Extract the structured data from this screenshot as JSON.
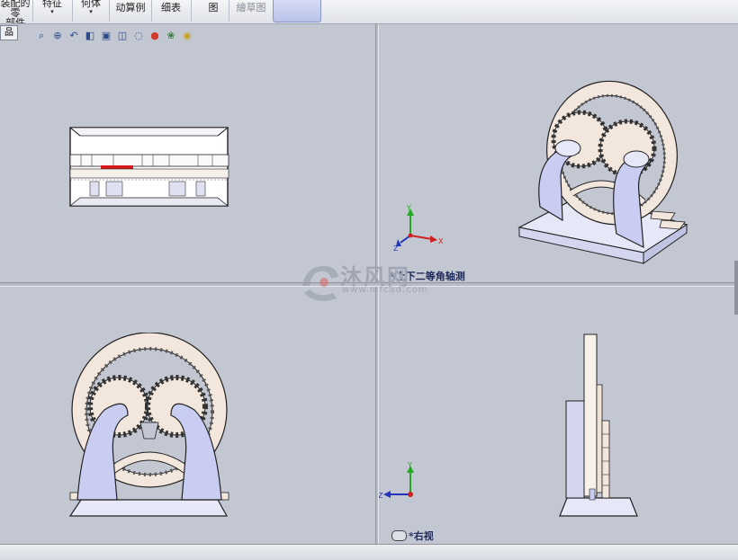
{
  "ribbon": {
    "items": [
      {
        "line1": "装配的零",
        "line2": "部件",
        "caret": false
      },
      {
        "line1": "特征",
        "line2": "",
        "caret": true
      },
      {
        "line1": "何体",
        "line2": "",
        "caret": true
      },
      {
        "line1": "动算例",
        "line2": "",
        "caret": false
      },
      {
        "line1": "细表",
        "line2": "",
        "caret": false
      },
      {
        "line1": "图",
        "line2": "",
        "caret": false
      },
      {
        "line1": "繪草图",
        "line2": "",
        "caret": false
      }
    ],
    "caret_glyph": "▾"
  },
  "tree_tab_label": "品",
  "hud_icons": [
    "zoom-to-fit-icon",
    "zoom-area-icon",
    "previous-view-icon",
    "section-view-icon",
    "view-orientation-icon",
    "display-style-icon",
    "hide-show-icon",
    "edit-appearance-icon",
    "apply-scene-icon",
    "view-settings-icon"
  ],
  "views": {
    "top_right_label": "*上下二等角轴测",
    "bottom_right_label": "*右视"
  },
  "triad": {
    "x": "X",
    "y": "Y",
    "z": "Z"
  },
  "watermark": {
    "brand": "沐风网",
    "url": "www.mfcad.com"
  },
  "colors": {
    "viewport_bg": "#c3c7d2",
    "gear": "#f3e6dc",
    "base": "#e6e8f8",
    "support": "#c9cdf2",
    "axis_x": "#cc2222",
    "axis_y": "#22aa22",
    "axis_z": "#2233bb"
  }
}
